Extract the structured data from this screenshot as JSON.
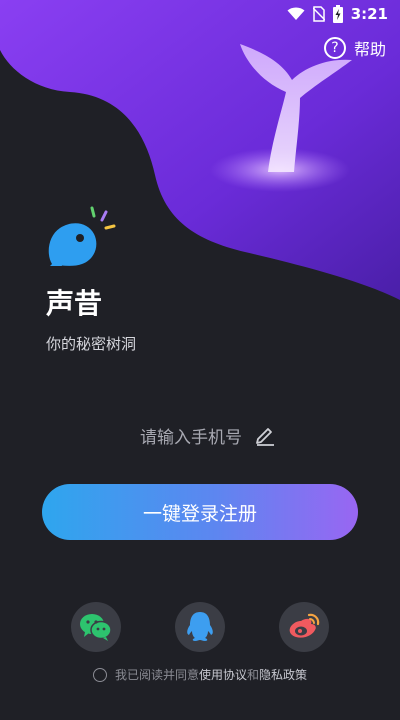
{
  "status_bar": {
    "time": "3:21",
    "icons": [
      "wifi-icon",
      "no-sim-icon",
      "battery-charging-icon"
    ]
  },
  "help": {
    "icon": "question-mark-icon",
    "symbol": "?",
    "label": "帮助"
  },
  "app": {
    "name": "声昔",
    "tagline": "你的秘密树洞",
    "logo_icon": "chat-bird-logo-icon"
  },
  "phone_input": {
    "placeholder": "请输入手机号",
    "value": "",
    "icon": "pencil-edit-icon"
  },
  "login_button": {
    "label": "一键登录注册"
  },
  "social_login": [
    {
      "name": "wechat",
      "icon": "wechat-icon",
      "color": "#2dc46e"
    },
    {
      "name": "qq",
      "icon": "qq-icon",
      "color": "#3d9ef0"
    },
    {
      "name": "weibo",
      "icon": "weibo-icon",
      "color": "#f05a5f"
    }
  ],
  "agreement": {
    "prefix": "我已阅读并同意",
    "terms_link": "使用协议",
    "and": "和",
    "privacy_link": "隐私政策",
    "checked": false
  },
  "colors": {
    "background": "#1f2026",
    "wave_gradient_start": "#7b3cf0",
    "wave_gradient_end": "#4a1fa8",
    "button_gradient_start": "#2ea6ee",
    "button_gradient_end": "#9966f2"
  }
}
